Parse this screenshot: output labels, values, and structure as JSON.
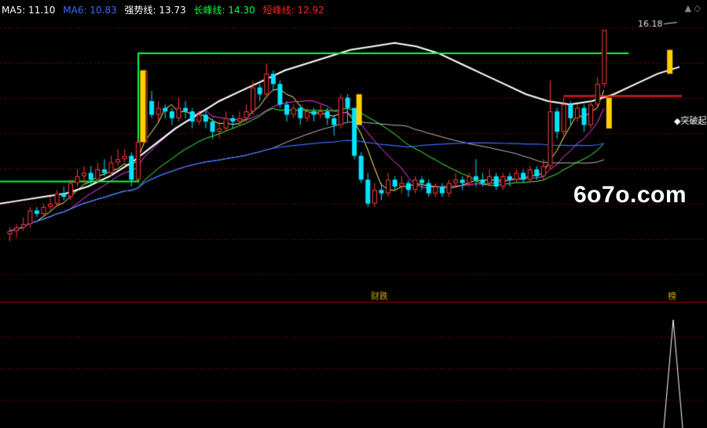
{
  "legend": {
    "ma5": "MA5: 11.10",
    "ma6": "MA6: 10.83",
    "strong_line": "强势线: 13.73",
    "long_peak": "长峰线: 14.30",
    "short_peak": "短峰线: 12.92"
  },
  "colors": {
    "background": "#000000",
    "up": "#ff3c3c",
    "down": "#00e5ff",
    "ma5": "#ffffff",
    "ma6": "#3a6bff",
    "strong_line": "#ffffff",
    "long_peak": "#00ff40",
    "short_peak": "#ff2020",
    "signal_bar": "#ffd000"
  },
  "icons": [
    "triangle-up-icon",
    "diamond-icon"
  ],
  "watermark": "6o7o.com",
  "annotations": {
    "max_price": "16.18",
    "breakout": "突破起",
    "event_left": "财跌",
    "event_right": "榜"
  },
  "chart_data": {
    "type": "candlestick",
    "ylim": [
      8.8,
      16.6
    ],
    "candles": [
      [
        10.2,
        10.3,
        10.0,
        10.4
      ],
      [
        10.3,
        10.4,
        10.1,
        10.5
      ],
      [
        10.4,
        10.5,
        10.3,
        10.7
      ],
      [
        10.5,
        10.9,
        10.4,
        11.0
      ],
      [
        10.9,
        10.8,
        10.7,
        11.0
      ],
      [
        10.8,
        11.0,
        10.7,
        11.1
      ],
      [
        11.0,
        11.1,
        10.9,
        11.3
      ],
      [
        11.1,
        11.4,
        11.0,
        11.5
      ],
      [
        11.4,
        11.3,
        11.2,
        11.6
      ],
      [
        11.3,
        11.7,
        11.2,
        11.8
      ],
      [
        11.7,
        11.9,
        11.6,
        12.1
      ],
      [
        11.9,
        12.0,
        11.7,
        12.2
      ],
      [
        12.0,
        11.8,
        11.6,
        12.2
      ],
      [
        11.8,
        12.1,
        11.7,
        12.3
      ],
      [
        12.1,
        12.0,
        11.9,
        12.4
      ],
      [
        12.0,
        12.3,
        11.9,
        12.5
      ],
      [
        12.3,
        12.4,
        12.2,
        12.7
      ],
      [
        12.4,
        12.5,
        12.3,
        12.7
      ],
      [
        12.5,
        11.8,
        11.6,
        12.6
      ],
      [
        11.8,
        12.9,
        11.8,
        13.0
      ],
      [
        12.9,
        15.0,
        12.9,
        15.0
      ],
      [
        14.1,
        13.7,
        13.6,
        14.4
      ],
      [
        13.7,
        13.9,
        13.5,
        14.1
      ],
      [
        13.9,
        13.8,
        13.6,
        14.0
      ],
      [
        13.8,
        13.6,
        13.4,
        13.9
      ],
      [
        13.6,
        13.9,
        13.5,
        14.2
      ],
      [
        13.9,
        13.8,
        13.6,
        14.1
      ],
      [
        13.8,
        13.5,
        13.3,
        13.9
      ],
      [
        13.5,
        13.7,
        13.4,
        13.8
      ],
      [
        13.7,
        13.5,
        13.3,
        13.8
      ],
      [
        13.5,
        13.2,
        13.0,
        13.6
      ],
      [
        13.2,
        13.3,
        13.0,
        13.5
      ],
      [
        13.3,
        13.6,
        13.2,
        13.8
      ],
      [
        13.6,
        13.5,
        13.3,
        13.7
      ],
      [
        13.5,
        13.6,
        13.4,
        13.8
      ],
      [
        13.6,
        13.8,
        13.5,
        14.0
      ],
      [
        13.8,
        14.5,
        13.7,
        14.7
      ],
      [
        14.5,
        14.3,
        14.1,
        14.6
      ],
      [
        14.3,
        14.9,
        14.2,
        15.2
      ],
      [
        14.9,
        14.6,
        14.4,
        15.0
      ],
      [
        14.6,
        14.0,
        13.9,
        14.7
      ],
      [
        14.0,
        13.7,
        13.5,
        14.1
      ],
      [
        13.7,
        13.9,
        13.6,
        14.0
      ],
      [
        13.9,
        13.6,
        13.4,
        14.0
      ],
      [
        13.6,
        13.8,
        13.5,
        13.9
      ],
      [
        13.8,
        13.7,
        13.5,
        13.9
      ],
      [
        13.7,
        13.8,
        13.6,
        14.0
      ],
      [
        13.8,
        13.6,
        13.4,
        13.9
      ],
      [
        13.6,
        13.4,
        13.1,
        13.7
      ],
      [
        13.4,
        14.2,
        13.3,
        14.3
      ],
      [
        14.2,
        13.9,
        13.5,
        14.3
      ],
      [
        13.9,
        12.5,
        12.4,
        13.9
      ],
      [
        12.5,
        11.8,
        11.7,
        12.6
      ],
      [
        11.8,
        11.1,
        11.0,
        12.0
      ],
      [
        11.1,
        11.5,
        11.0,
        11.7
      ],
      [
        11.5,
        11.4,
        11.2,
        11.7
      ],
      [
        11.4,
        11.8,
        11.3,
        12.0
      ],
      [
        11.8,
        11.6,
        11.5,
        11.9
      ],
      [
        11.6,
        11.7,
        11.4,
        11.9
      ],
      [
        11.7,
        11.5,
        11.3,
        11.8
      ],
      [
        11.5,
        11.8,
        11.4,
        11.9
      ],
      [
        11.8,
        11.7,
        11.5,
        11.9
      ],
      [
        11.7,
        11.4,
        11.3,
        11.8
      ],
      [
        11.4,
        11.6,
        11.3,
        11.7
      ],
      [
        11.6,
        11.4,
        11.3,
        11.7
      ],
      [
        11.4,
        11.7,
        11.3,
        11.8
      ],
      [
        11.7,
        11.8,
        11.6,
        12.0
      ],
      [
        11.8,
        11.7,
        11.5,
        11.9
      ],
      [
        11.7,
        11.9,
        11.6,
        12.0
      ],
      [
        11.9,
        11.8,
        11.6,
        12.4
      ],
      [
        11.8,
        11.7,
        11.6,
        12.0
      ],
      [
        11.7,
        11.9,
        11.6,
        12.1
      ],
      [
        11.9,
        11.6,
        11.5,
        12.0
      ],
      [
        11.6,
        11.9,
        11.5,
        12.0
      ],
      [
        11.9,
        11.8,
        11.6,
        12.0
      ],
      [
        11.8,
        12.0,
        11.7,
        12.1
      ],
      [
        12.0,
        11.8,
        11.7,
        12.1
      ],
      [
        11.8,
        12.1,
        11.7,
        12.2
      ],
      [
        12.1,
        11.9,
        11.8,
        12.2
      ],
      [
        11.9,
        12.2,
        11.8,
        12.4
      ],
      [
        12.2,
        13.8,
        12.1,
        14.7
      ],
      [
        13.8,
        13.2,
        13.0,
        13.9
      ],
      [
        13.2,
        14.0,
        13.1,
        14.2
      ],
      [
        14.0,
        13.6,
        13.4,
        14.1
      ],
      [
        13.6,
        13.9,
        13.5,
        14.0
      ],
      [
        13.9,
        13.4,
        13.2,
        14.0
      ],
      [
        13.4,
        14.0,
        13.3,
        14.1
      ],
      [
        14.0,
        14.6,
        13.9,
        14.8
      ],
      [
        14.6,
        16.18,
        14.5,
        16.18
      ]
    ],
    "strong_line": [
      11.1,
      11.2,
      11.3,
      11.4,
      11.6,
      11.9,
      12.3,
      12.8,
      13.3,
      13.7,
      14.1,
      14.4,
      14.7,
      15.0,
      15.2,
      15.4,
      15.6,
      15.7,
      15.8,
      15.7,
      15.5,
      15.2,
      14.9,
      14.6,
      14.3,
      14.1,
      14.0,
      14.1,
      14.3,
      14.6,
      14.9,
      15.1
    ],
    "long_peak_steps": [
      [
        0,
        11.75
      ],
      [
        22,
        11.75
      ],
      [
        22,
        15.5
      ],
      [
        100,
        15.5
      ]
    ],
    "short_peak_steps": [
      [
        90,
        14.25
      ],
      [
        100,
        14.25
      ]
    ]
  }
}
